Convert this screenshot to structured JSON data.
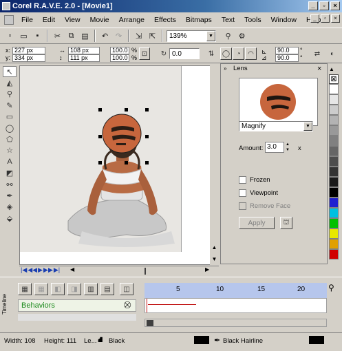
{
  "app": {
    "title": "Corel R.A.V.E. 2.0 - [Movie1]"
  },
  "window_controls": {
    "min": "_",
    "max": "▫",
    "close": "×"
  },
  "menu": [
    {
      "label": "File"
    },
    {
      "label": "Edit"
    },
    {
      "label": "View"
    },
    {
      "label": "Movie"
    },
    {
      "label": "Arrange"
    },
    {
      "label": "Effects"
    },
    {
      "label": "Bitmaps"
    },
    {
      "label": "Text"
    },
    {
      "label": "Tools"
    },
    {
      "label": "Window"
    },
    {
      "label": "Help"
    }
  ],
  "toolbar": {
    "zoom": "139%"
  },
  "propbar": {
    "x": "227 px",
    "y": "334 px",
    "w": "108 px",
    "h": "111 px",
    "sx": "100.0",
    "sy": "100.0",
    "pct": "%",
    "rot": "0.0",
    "r1": "90.0",
    "r2": "90.0",
    "deg": "°"
  },
  "lens": {
    "title": "Lens",
    "mode": "Magnify",
    "amount_label": "Amount:",
    "amount_value": "3.0",
    "amount_unit": "x",
    "frozen": "Frozen",
    "viewpoint": "Viewpoint",
    "remove_face": "Remove Face",
    "apply": "Apply",
    "frozen_checked": false,
    "viewpoint_checked": false
  },
  "palette": [
    "#ffffff",
    "#e6e6e6",
    "#cccccc",
    "#b3b3b3",
    "#999999",
    "#808080",
    "#666666",
    "#4d4d4d",
    "#333333",
    "#1a1a1a",
    "#000000",
    "#1f1fd0",
    "#00c0e0",
    "#00c000",
    "#e8e800",
    "#e0a000",
    "#d00000"
  ],
  "timeline": {
    "label": "Timeline",
    "behaviors": "Behaviors",
    "ticks": [
      "5",
      "10",
      "15",
      "20"
    ]
  },
  "status": {
    "width": "Width: 108",
    "height": "Height: 111",
    "layer": "Le...",
    "fill": "Black",
    "outline": "Black  Hairline"
  }
}
